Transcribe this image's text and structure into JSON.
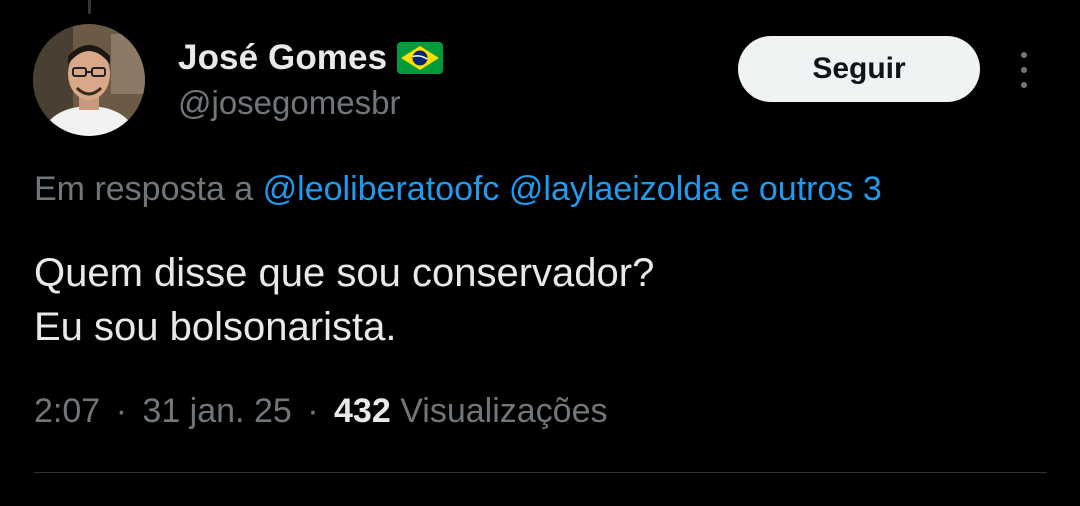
{
  "tweet": {
    "author": {
      "display_name": "José Gomes",
      "handle": "@josegomesbr",
      "badge_icon": "brazil-flag-icon"
    },
    "follow_label": "Seguir",
    "more_icon": "more-vertical-icon",
    "reply_context": {
      "prefix": "Em resposta a",
      "mentions": [
        "@leoliberatoofc",
        "@laylaeizolda"
      ],
      "others": "e outros 3"
    },
    "text_lines": [
      "Quem disse que sou conservador?",
      "Eu sou bolsonarista."
    ],
    "meta": {
      "time": "2:07",
      "date": "31 jan. 25",
      "views_count": "432",
      "views_label": "Visualizações",
      "separator": "·"
    }
  },
  "colors": {
    "background": "#000000",
    "primary_text": "#e7e9ea",
    "secondary_text": "#71767b",
    "link": "#1d9bf0",
    "follow_bg": "#eff3f4",
    "divider": "#2f3336"
  }
}
